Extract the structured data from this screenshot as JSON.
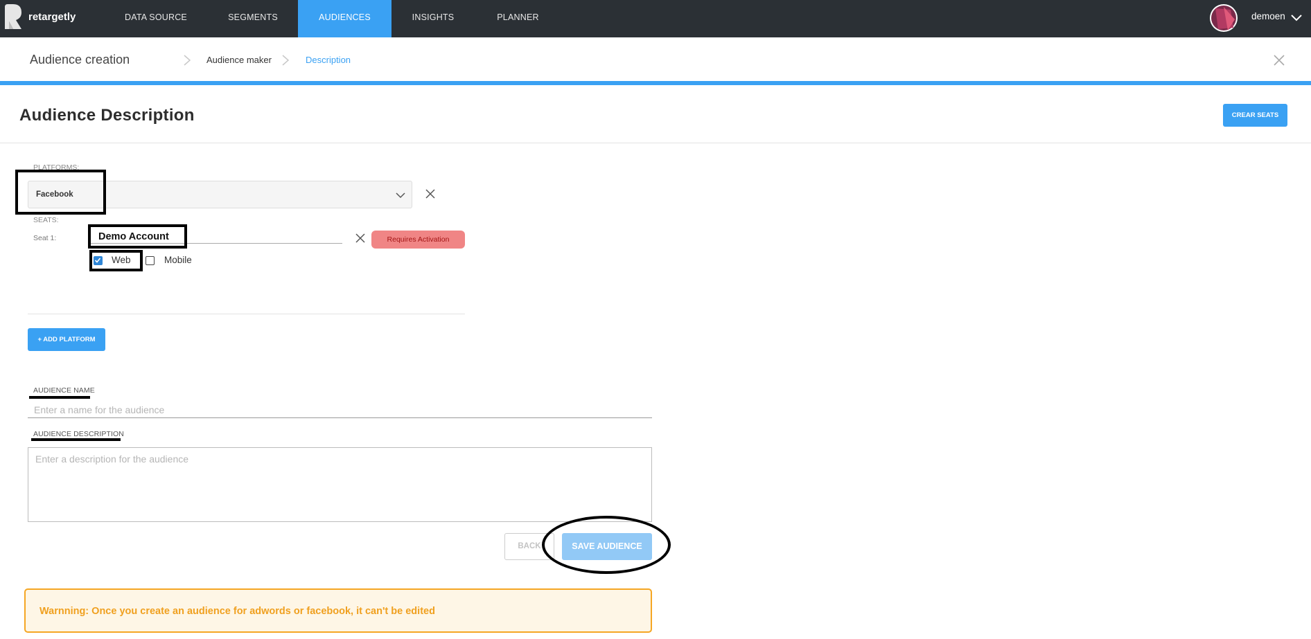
{
  "nav": {
    "brand": "retargetly",
    "items": [
      {
        "label": "DATA SOURCE",
        "active": false
      },
      {
        "label": "SEGMENTS",
        "active": false
      },
      {
        "label": "AUDIENCES",
        "active": true
      },
      {
        "label": "INSIGHTS",
        "active": false
      },
      {
        "label": "PLANNER",
        "active": false
      }
    ],
    "username": "demoen"
  },
  "breadcrumb": {
    "title": "Audience creation",
    "steps": [
      "Audience maker",
      "Description"
    ]
  },
  "header": {
    "title": "Audience Description",
    "create_seats_label": "CREAR SEATS"
  },
  "platforms": {
    "label": "PLATFORMS:",
    "selected": "Facebook",
    "seats_label": "SEATS:",
    "seat": {
      "label": "Seat 1:",
      "value": "Demo Account",
      "status": "Requires Activation",
      "options": [
        {
          "label": "Web",
          "checked": true
        },
        {
          "label": "Mobile",
          "checked": false
        }
      ]
    },
    "add_label": "+ ADD PLATFORM"
  },
  "audience_name": {
    "label": "AUDIENCE NAME",
    "placeholder": "Enter a name for the audience",
    "value": ""
  },
  "audience_description": {
    "label": "AUDIENCE DESCRIPTION",
    "placeholder": "Enter a description for the audience",
    "value": ""
  },
  "actions": {
    "back_label": "BACK",
    "save_label": "SAVE AUDIENCE"
  },
  "warning": "Warnning: Once you create an audience for adwords or facebook, it can't be edited",
  "colors": {
    "nav_bg": "#2b3035",
    "accent": "#3aa1f3",
    "badge_bg": "#f08585",
    "warning_border": "#f5a623",
    "warning_text": "#f0a01f"
  }
}
